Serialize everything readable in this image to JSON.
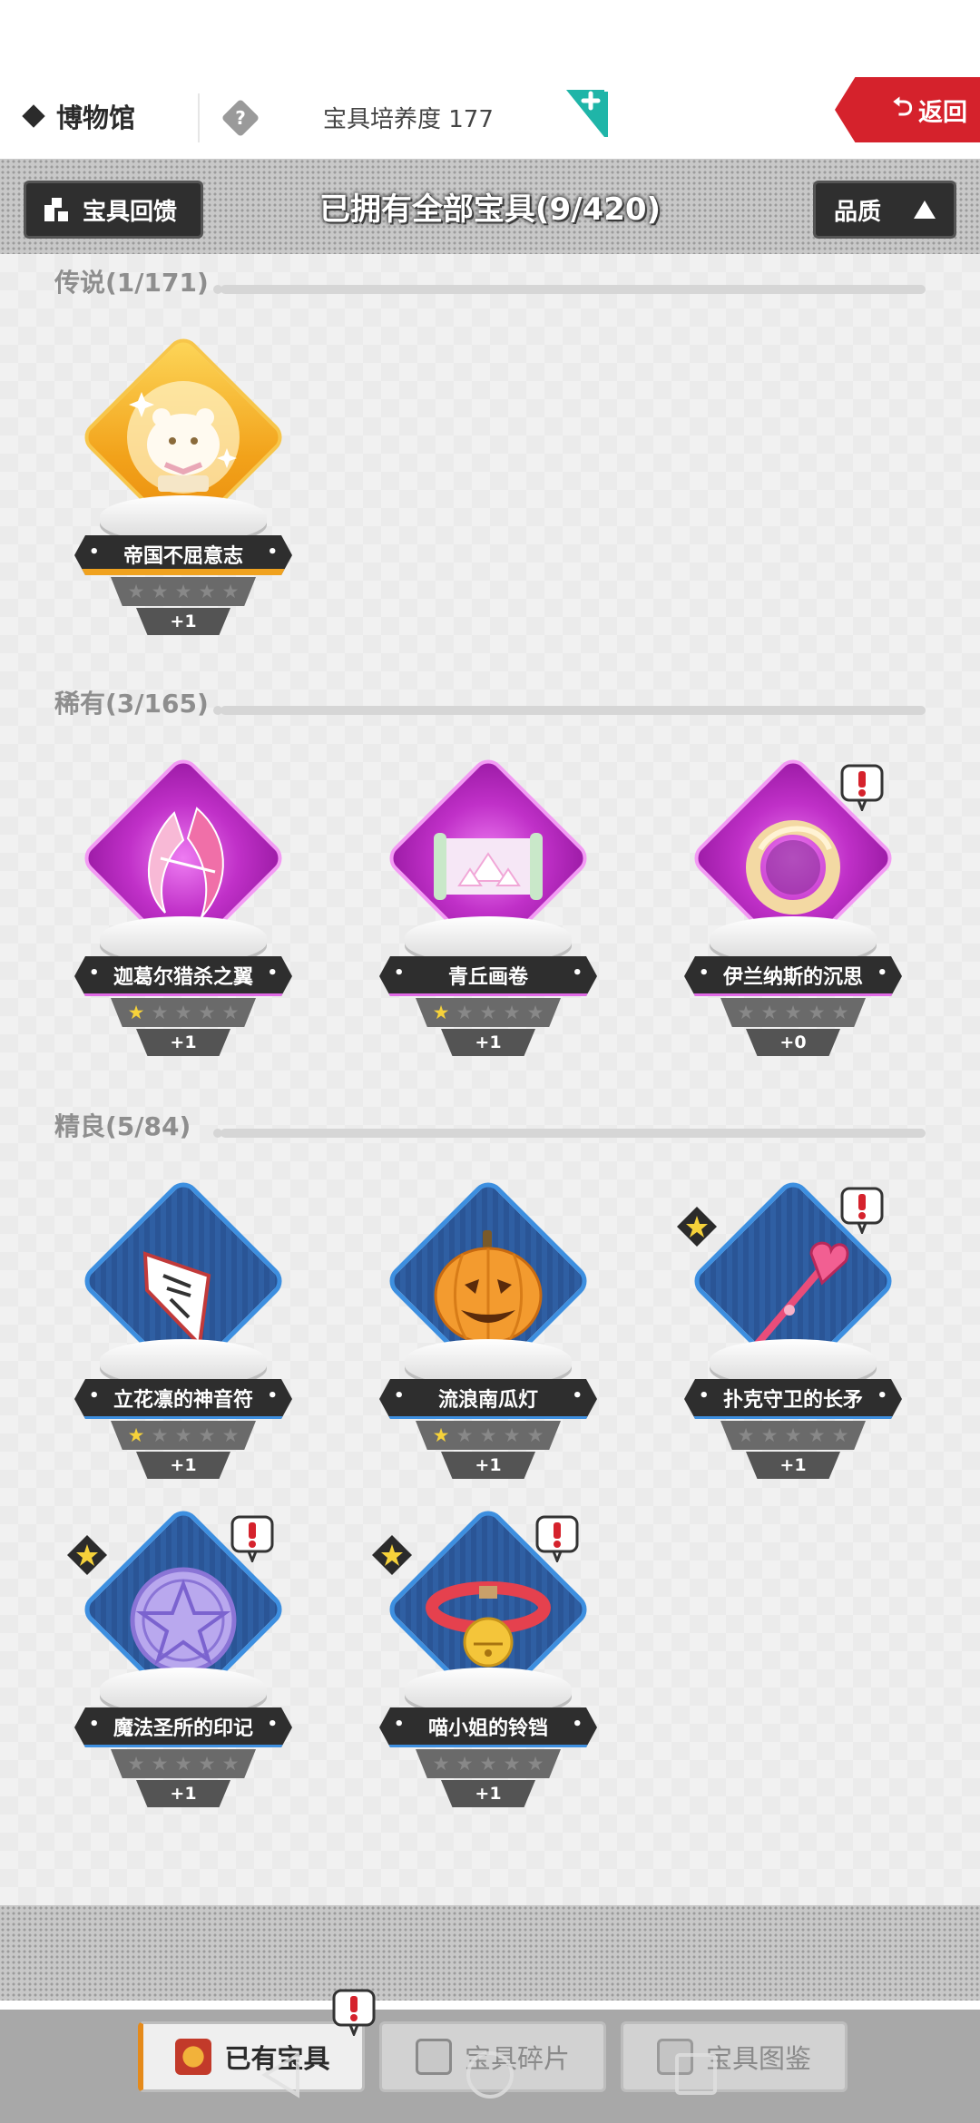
{
  "topbar": {
    "title": "博物馆",
    "cultivation_label": "宝具培养度 177",
    "back_label": "返回"
  },
  "header": {
    "feedback_button": "宝具回馈",
    "owned_title": "已拥有全部宝具(9/420)",
    "sort_button": "品质"
  },
  "sections": [
    {
      "label": "传说(1/171)",
      "tier": "legend"
    },
    {
      "label": "稀有(3/165)",
      "tier": "rare"
    },
    {
      "label": "精良(5/84)",
      "tier": "fine"
    }
  ],
  "items": [
    {
      "name": "帝国不屈意志",
      "tier": "legend",
      "stars": 0,
      "plus": "+1",
      "alert": false,
      "new_star": false
    },
    {
      "name": "迦葛尔猎杀之翼",
      "tier": "rare",
      "stars": 1,
      "plus": "+1",
      "alert": false,
      "new_star": false
    },
    {
      "name": "青丘画卷",
      "tier": "rare",
      "stars": 1,
      "plus": "+1",
      "alert": false,
      "new_star": false
    },
    {
      "name": "伊兰纳斯的沉思",
      "tier": "rare",
      "stars": 0,
      "plus": "+0",
      "alert": true,
      "new_star": false
    },
    {
      "name": "立花凛的神音符",
      "tier": "fine",
      "stars": 1,
      "plus": "+1",
      "alert": false,
      "new_star": false
    },
    {
      "name": "流浪南瓜灯",
      "tier": "fine",
      "stars": 1,
      "plus": "+1",
      "alert": false,
      "new_star": false
    },
    {
      "name": "扑克守卫的长矛",
      "tier": "fine",
      "stars": 0,
      "plus": "+1",
      "alert": true,
      "new_star": true
    },
    {
      "name": "魔法圣所的印记",
      "tier": "fine",
      "stars": 0,
      "plus": "+1",
      "alert": true,
      "new_star": true
    },
    {
      "name": "喵小姐的铃铛",
      "tier": "fine",
      "stars": 0,
      "plus": "+1",
      "alert": true,
      "new_star": true
    }
  ],
  "tabs": [
    {
      "label": "已有宝具",
      "active": true
    },
    {
      "label": "宝具碎片",
      "active": false
    },
    {
      "label": "宝具图鉴",
      "active": false
    }
  ],
  "colors": {
    "legend": "#f2a21a",
    "rare": "#c030c8",
    "fine": "#3d8fe0",
    "back_button": "#d5222c",
    "alert": "#d5222c"
  }
}
